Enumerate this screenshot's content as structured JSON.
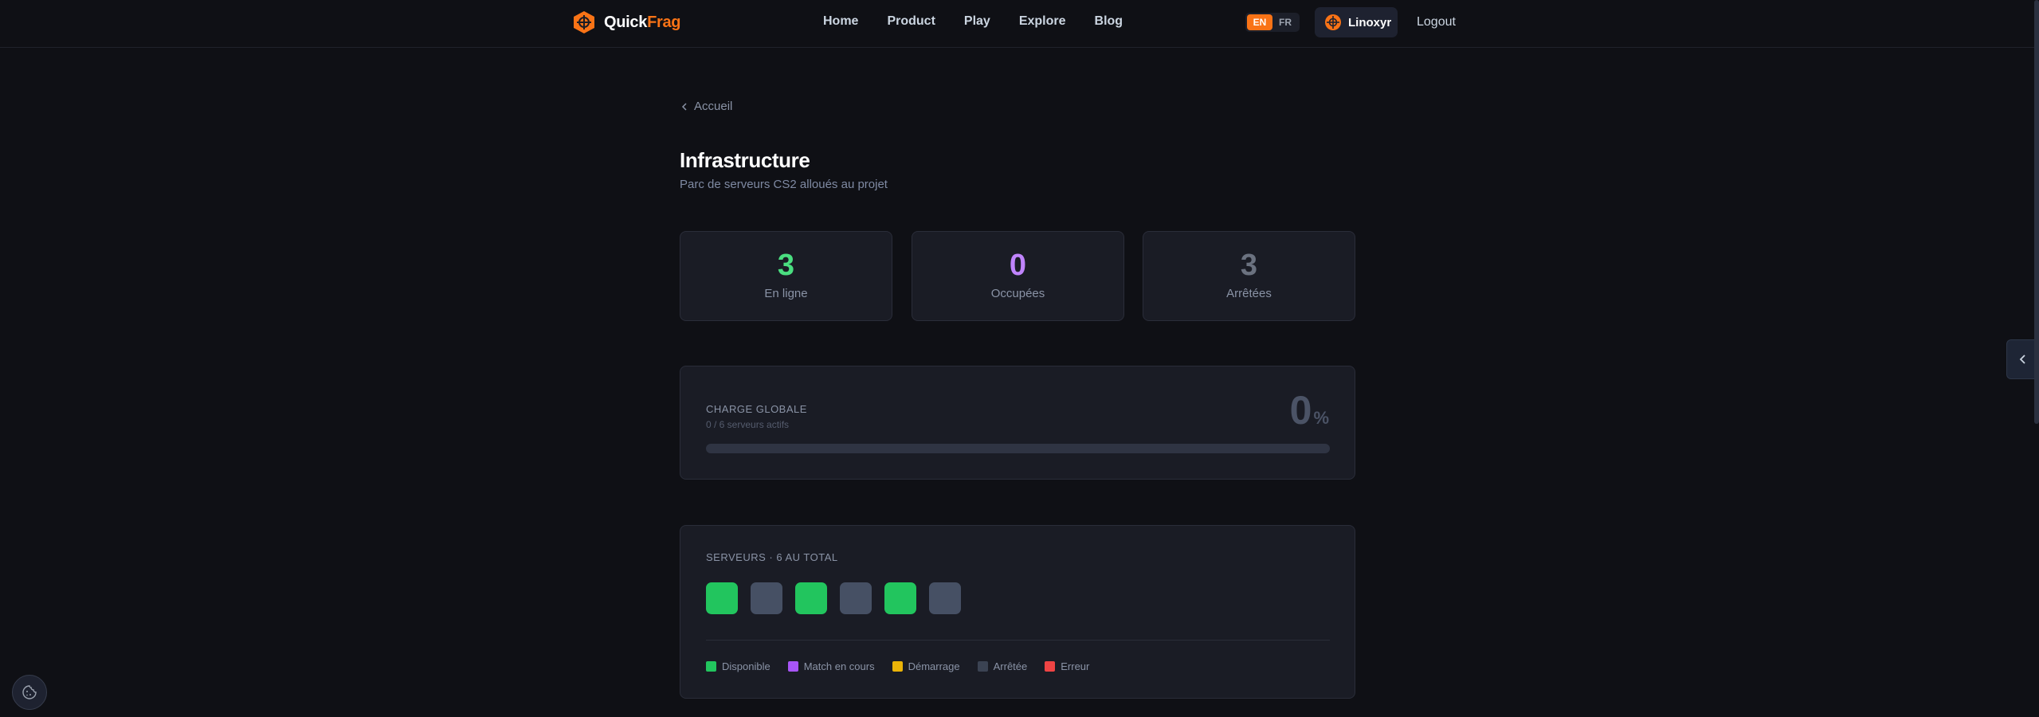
{
  "header": {
    "brand_part1": "Quick",
    "brand_part2": "Frag",
    "nav": [
      "Home",
      "Product",
      "Play",
      "Explore",
      "Blog"
    ],
    "lang_en": "EN",
    "lang_fr": "FR",
    "active_lang": "EN",
    "username": "Linoxyr",
    "logout_label": "Logout"
  },
  "page": {
    "back_label": "Accueil",
    "title": "Infrastructure",
    "subtitle": "Parc de serveurs CS2 alloués au projet"
  },
  "stats": [
    {
      "value": "3",
      "label": "En ligne",
      "color": "#4ade80"
    },
    {
      "value": "0",
      "label": "Occupées",
      "color": "#c084fc"
    },
    {
      "value": "3",
      "label": "Arrêtées",
      "color": "#6b7280"
    }
  ],
  "load": {
    "title": "CHARGE GLOBALE",
    "subtitle": "0 / 6 serveurs actifs",
    "value": "0",
    "unit": "%",
    "progress_fraction": 0
  },
  "servers": {
    "title": "SERVEURS · 6 AU TOTAL",
    "tiles": [
      "available",
      "stopped",
      "available",
      "stopped",
      "available",
      "stopped"
    ],
    "legend": [
      {
        "label": "Disponible",
        "color": "#22c55e"
      },
      {
        "label": "Match en cours",
        "color": "#a855f7"
      },
      {
        "label": "Démarrage",
        "color": "#eab308"
      },
      {
        "label": "Arrêtée",
        "color": "#3b4353"
      },
      {
        "label": "Erreur",
        "color": "#ef4444"
      }
    ],
    "status_colors": {
      "available": "#22c55e",
      "stopped": "#465064"
    }
  },
  "colors": {
    "accent": "#f97316",
    "background": "#0f1015",
    "card": "#1a1c25"
  },
  "icons": {
    "brand": "quickfrag-logo-icon",
    "back": "chevron-left-icon",
    "side_toggle": "chevron-left-icon",
    "cookie": "cookie-icon"
  }
}
